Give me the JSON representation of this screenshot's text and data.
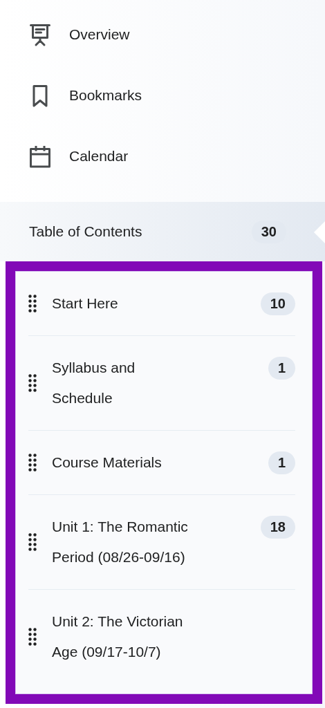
{
  "nav_items": [
    {
      "label": "Overview"
    },
    {
      "label": "Bookmarks"
    },
    {
      "label": "Calendar"
    }
  ],
  "table_of_contents": {
    "label": "Table of Contents",
    "count": "30",
    "selected": true
  },
  "modules": [
    {
      "title": "Start Here",
      "count": "10"
    },
    {
      "title": "Syllabus and Schedule",
      "count": "1"
    },
    {
      "title": "Course Materials",
      "count": "1"
    },
    {
      "title": "Unit 1: The Romantic Period (08/26-09/16)",
      "count": "18"
    },
    {
      "title": "Unit 2: The Victorian Age (09/17-10/7)"
    }
  ]
}
